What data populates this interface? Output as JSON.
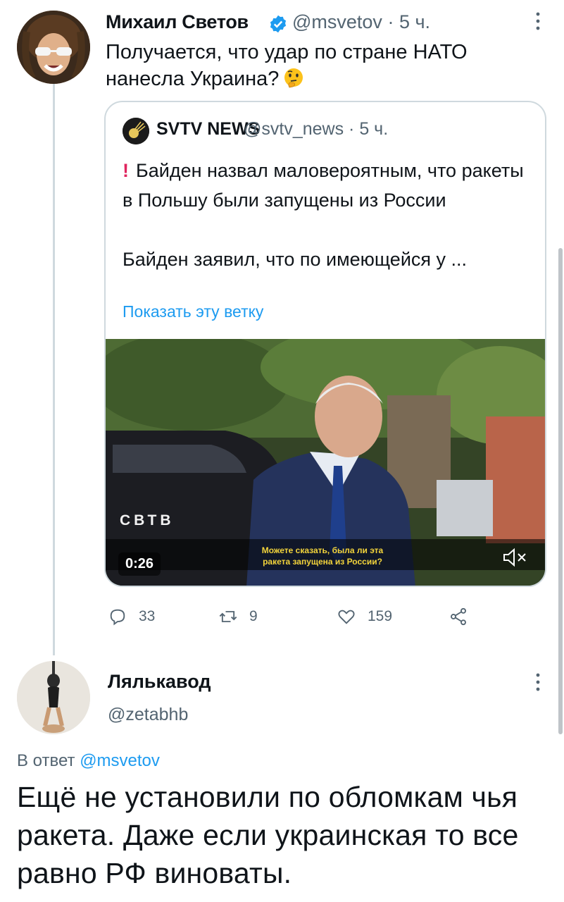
{
  "tweet_1": {
    "name": "Михаил Светов",
    "handle": "@msvetov",
    "time": "· 5 ч.",
    "text": "Получается, что удар по стране НАТО нанесла Украина?",
    "emoji": "thinking-face-icon"
  },
  "quote": {
    "name": "SVTV NEWS",
    "handle": "@svtv_news",
    "time": "· 5 ч.",
    "exclaim": "!",
    "text_1": "Байден назвал маловероятным, что ракеты в Польшу были запущены из России",
    "text_2": "Байден заявил, что по имеющейся у ...",
    "show_thread": "Показать эту ветку",
    "video": {
      "duration": "0:26",
      "caption_line_1": "Можете сказать, была ли эта",
      "caption_line_2": "ракета запущена из России?",
      "logo": "СВТВ"
    }
  },
  "actions": {
    "replies": "33",
    "retweets": "9",
    "likes": "159"
  },
  "tweet_2": {
    "name": "Лялькавод",
    "handle": "@zetabhb",
    "reply_prefix": "В ответ",
    "reply_handle": "@msvetov",
    "text": "Ещё не установили по обломкам чья ракета. Даже если украинская то все равно РФ виноваты."
  },
  "colors": {
    "accent": "#1d9bf0",
    "muted": "#536471",
    "border": "#cfd9de",
    "verified": "#1d9bf0",
    "alert": "#e0245e"
  }
}
